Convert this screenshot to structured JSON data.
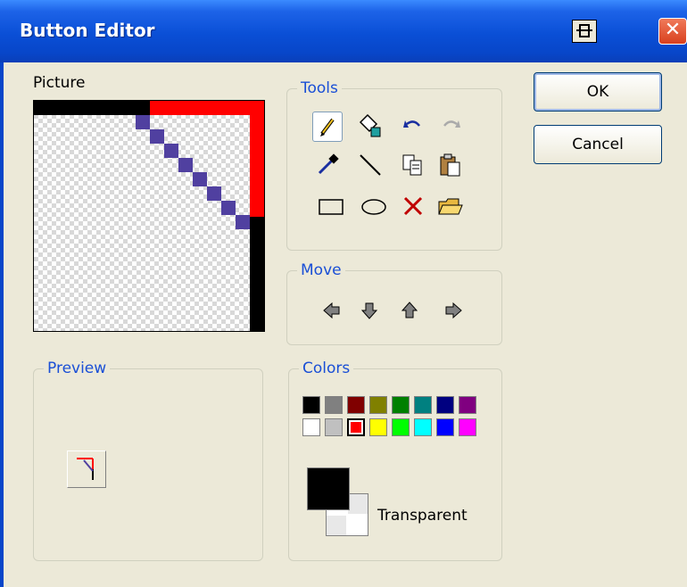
{
  "window": {
    "title": "Button Editor"
  },
  "picture": {
    "label": "Picture"
  },
  "tools": {
    "label": "Tools",
    "items": [
      "pencil",
      "fill",
      "undo",
      "redo",
      "eyedropper",
      "line",
      "copy",
      "paste",
      "rectangle",
      "ellipse",
      "clear",
      "open"
    ]
  },
  "move": {
    "label": "Move",
    "directions": [
      "left",
      "down",
      "up",
      "right"
    ]
  },
  "preview": {
    "label": "Preview"
  },
  "colors": {
    "label": "Colors",
    "palette_row1": [
      "#000000",
      "#808080",
      "#800000",
      "#808000",
      "#008000",
      "#008080",
      "#000080",
      "#800080"
    ],
    "palette_row2": [
      "#ffffff",
      "#c0c0c0",
      "#ff0000",
      "#ffff00",
      "#00ff00",
      "#00ffff",
      "#0000ff",
      "#ff00ff"
    ],
    "selected_color": "#ff0000",
    "foreground": "#000000",
    "transparent_label": "Transparent"
  },
  "buttons": {
    "ok_label": "OK",
    "cancel_label": "Cancel"
  }
}
